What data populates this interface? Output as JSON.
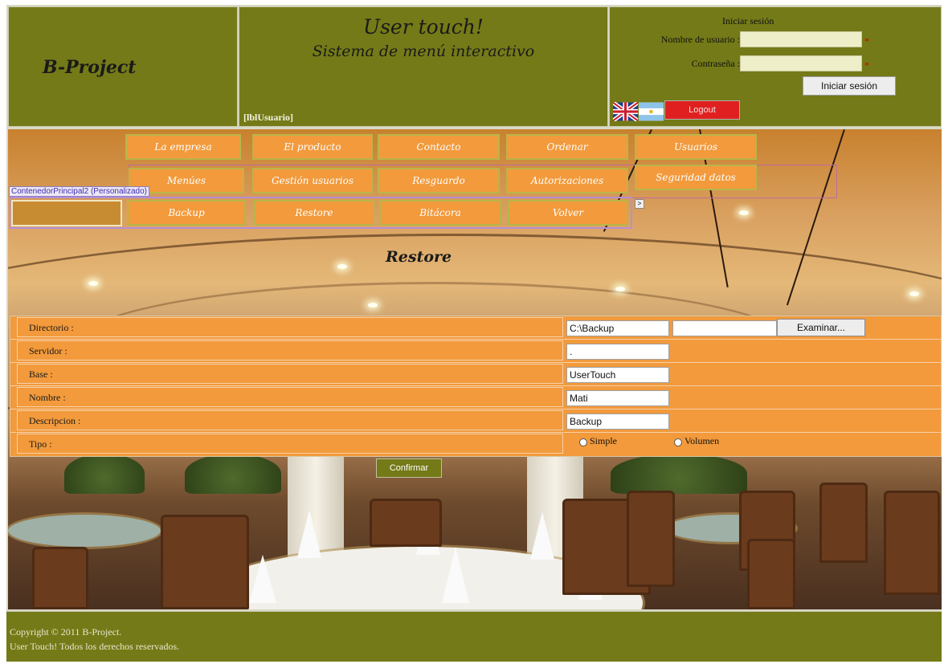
{
  "header": {
    "brand": "B-Project",
    "app_title": "User touch!",
    "app_subtitle": "Sistema de menú interactivo",
    "user_label": "[lblUsuario]",
    "login": {
      "title": "Iniciar sesión",
      "username_label": "Nombre de usuario :",
      "password_label": "Contraseña :",
      "required_mark": "*",
      "submit_label": "Iniciar sesión",
      "logout_label": "Logout"
    }
  },
  "menu": {
    "row1": [
      "La empresa",
      "El producto",
      "Contacto",
      "Ordenar",
      "Usuarios"
    ],
    "row2": [
      "Menúes",
      "Gestión usuarios",
      "Resguardo",
      "Autorizaciones",
      "Seguridad datos"
    ],
    "row3": [
      "Backup",
      "Restore",
      "Bitácora",
      "Volver"
    ],
    "container_label": "ContenedorPrincipal2 (Personalizado)",
    "expand_glyph": ">"
  },
  "page_heading": "Restore",
  "form": {
    "rows": [
      {
        "label": "Directorio :",
        "value": "C:\\Backup"
      },
      {
        "label": "Servidor :",
        "value": "."
      },
      {
        "label": "Base :",
        "value": "UserTouch"
      },
      {
        "label": "Nombre :",
        "value": "Mati"
      },
      {
        "label": "Descripcion :",
        "value": "Backup"
      },
      {
        "label": "Tipo :"
      }
    ],
    "browse_label": "Examinar...",
    "type_options": [
      "Simple",
      "Volumen"
    ],
    "confirm_label": "Confirmar"
  },
  "footer": {
    "line1": "Copyright © 2011 B-Project.",
    "line2": "User Touch! Todos los derechos reservados."
  },
  "colors": {
    "header_bg": "#747a17",
    "menu_button": "#f29a3c",
    "form_bg": "#f29a3c",
    "logout_button": "#e02020"
  },
  "icons": [
    "uk-flag-icon",
    "argentina-flag-icon",
    "radio-button-icon"
  ]
}
